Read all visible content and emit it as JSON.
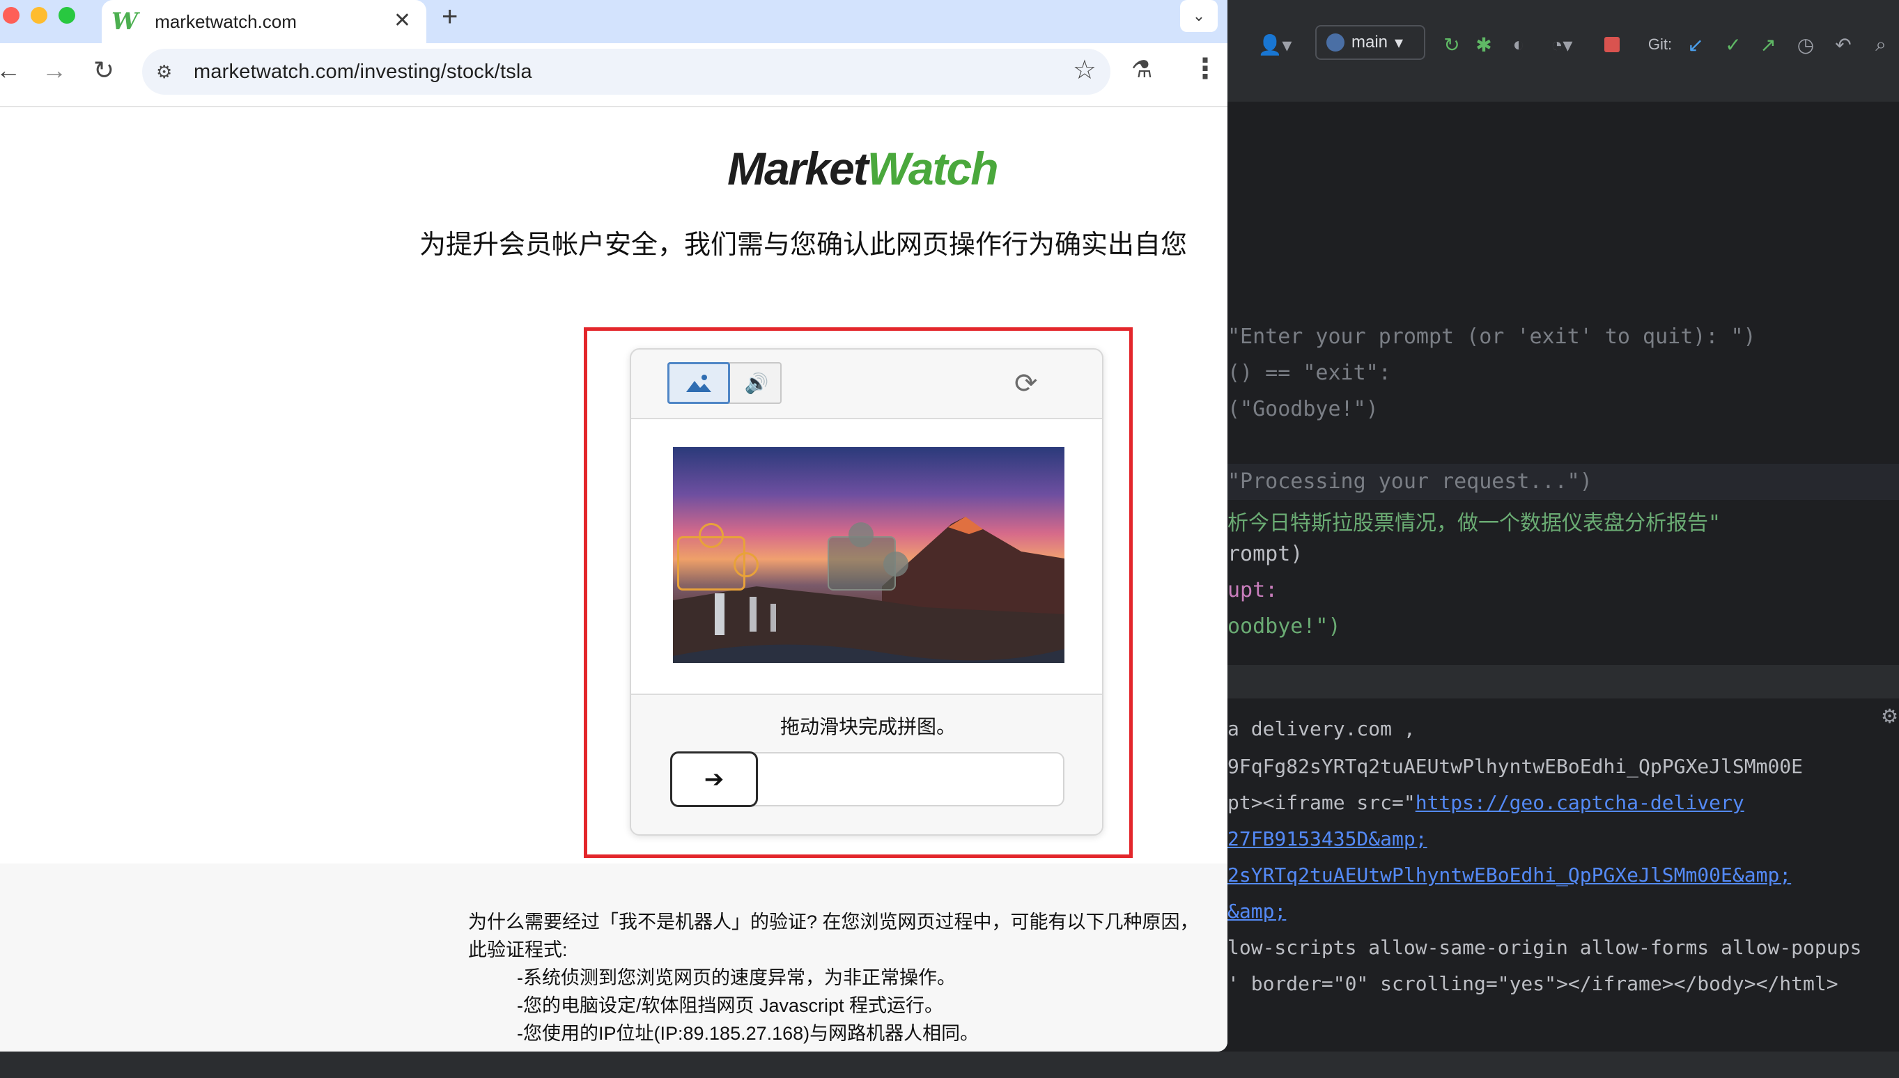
{
  "browser": {
    "tab_title": "marketwatch.com",
    "tab_favicon": "W",
    "new_tab": "+",
    "tab_close": "✕",
    "url": "marketwatch.com/investing/stock/tsla"
  },
  "page": {
    "logo_part1": "Market",
    "logo_part2": "Watch",
    "headline": "为提升会员帐户安全，我们需与您确认此网页操作行为确实出自您",
    "captcha": {
      "instruction": "拖动滑块完成拼图。",
      "slider_arrow": "➔",
      "mode_image_icon": "image-icon",
      "mode_audio_icon": "audio-icon",
      "refresh_icon": "refresh-icon"
    },
    "info": {
      "line1": "为什么需要经过「我不是机器人」的验证? 在您浏览网页过程中，可能有以下几种原因，",
      "line2": "此验证程式:",
      "line3": "-系统侦测到您浏览网页的速度异常，为非正常操作。",
      "line4": "-您的电脑设定/软体阻挡网页 Javascript 程式运行。",
      "line5": "-您使用的IP位址(IP:89.185.27.168)与网路机器人相同。"
    }
  },
  "ide": {
    "branch": "main",
    "git_label": "Git:",
    "code": [
      "\"Enter your prompt (or 'exit' to quit): \")",
      "() == \"exit\":",
      "(\"Goodbye!\")",
      "\"Processing your request...\")",
      "析今日特斯拉股票情况，做一个数据仪表盘分析报告\"",
      "rompt)",
      "upt:",
      "oodbye!\")"
    ],
    "console": [
      "a delivery.com ,",
      "9FqFg82sYRTq2tuAEUtwPlhyntwEBoEdhi_QpPGXeJlSMm00E",
      "pt><iframe src=\"",
      "https://geo.captcha-delivery",
      "27FB9153435D&amp;",
      "2sYRTq2tuAEUtwPlhyntwEBoEdhi_QpPGXeJlSMm00E&amp;",
      "&amp;",
      "low-scripts allow-same-origin allow-forms allow-popups",
      "' border=\"0\" scrolling=\"yes\"></iframe></body></html>"
    ]
  },
  "colors": {
    "accent_red": "#e3262b",
    "brand_green": "#4aa83c",
    "captcha_blue": "#4f86c6"
  }
}
